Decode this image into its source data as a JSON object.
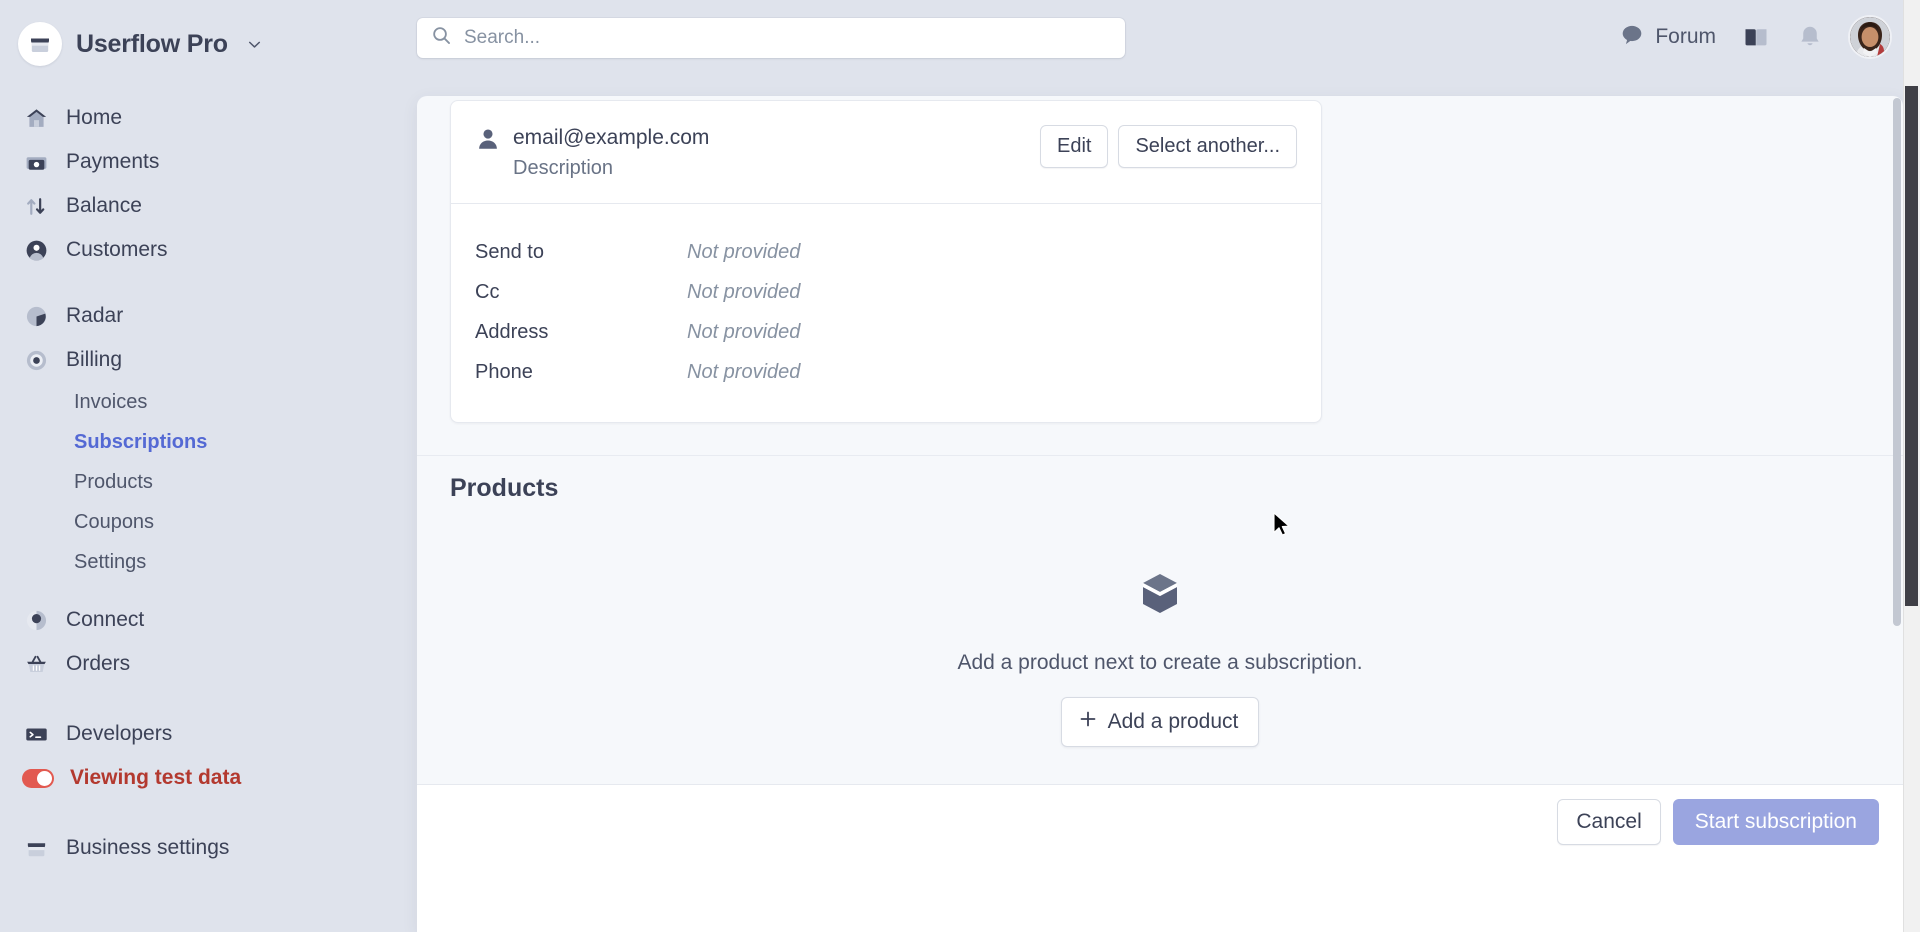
{
  "sidebar": {
    "brand": {
      "name": "Userflow Pro",
      "logo_icon": "storefront-icon",
      "caret_icon": "chevron-down-icon"
    },
    "primary_items": [
      {
        "label": "Home",
        "icon": "home-icon"
      },
      {
        "label": "Payments",
        "icon": "payments-icon"
      },
      {
        "label": "Balance",
        "icon": "balance-arrows-icon"
      },
      {
        "label": "Customers",
        "icon": "customers-icon"
      }
    ],
    "secondary_items": [
      {
        "label": "Radar",
        "icon": "radar-icon"
      },
      {
        "label": "Billing",
        "icon": "billing-icon"
      }
    ],
    "billing_subitems": [
      {
        "label": "Invoices",
        "active": false
      },
      {
        "label": "Subscriptions",
        "active": true
      },
      {
        "label": "Products",
        "active": false
      },
      {
        "label": "Coupons",
        "active": false
      },
      {
        "label": "Settings",
        "active": false
      }
    ],
    "tertiary_items": [
      {
        "label": "Connect",
        "icon": "connect-icon"
      },
      {
        "label": "Orders",
        "icon": "orders-basket-icon"
      }
    ],
    "developers": {
      "label": "Developers",
      "icon": "terminal-icon"
    },
    "test_data_toggle": {
      "label": "Viewing test data",
      "enabled": true,
      "color": "#e25950"
    },
    "business_settings": {
      "label": "Business settings",
      "icon": "storefront-icon"
    },
    "active_color": "#5469d4"
  },
  "topbar": {
    "search": {
      "placeholder": "Search...",
      "value": "",
      "icon": "search-icon"
    },
    "forum": {
      "label": "Forum",
      "icon": "chat-bubble-icon"
    },
    "docs_icon": "book-icon",
    "notifications_icon": "bell-icon",
    "avatar": "user-avatar"
  },
  "modal": {
    "customer_card": {
      "person_icon": "person-icon",
      "email": "email@example.com",
      "description": "Description",
      "edit_label": "Edit",
      "select_another_label": "Select another...",
      "fields": [
        {
          "label": "Send to",
          "value": "Not provided"
        },
        {
          "label": "Cc",
          "value": "Not provided"
        },
        {
          "label": "Address",
          "value": "Not provided"
        },
        {
          "label": "Phone",
          "value": "Not provided"
        }
      ]
    },
    "products_section": {
      "title": "Products",
      "empty_icon": "cube-icon",
      "empty_text": "Add a product next to create a subscription.",
      "add_product_label": "Add a product",
      "add_icon": "plus-icon"
    },
    "footer": {
      "cancel_label": "Cancel",
      "submit_label": "Start subscription",
      "submit_color": "#9aa5e0"
    }
  }
}
